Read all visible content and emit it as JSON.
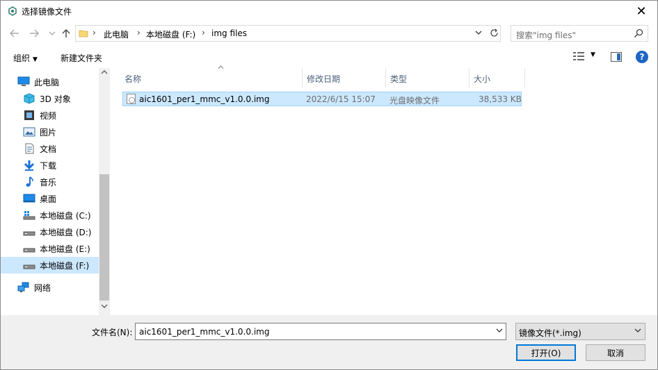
{
  "window": {
    "title": "选择镜像文件",
    "close_glyph": "✕"
  },
  "address": {
    "crumbs": [
      "此电脑",
      "本地磁盘 (F:)",
      "img files"
    ],
    "separator": "›"
  },
  "search": {
    "placeholder": "搜索\"img files\""
  },
  "toolbar": {
    "organize": "组织",
    "new_folder": "新建文件夹"
  },
  "sidebar": {
    "items": [
      {
        "label": "此电脑",
        "icon": "computer-icon"
      },
      {
        "label": "3D 对象",
        "icon": "3d-objects-icon"
      },
      {
        "label": "视频",
        "icon": "video-icon"
      },
      {
        "label": "图片",
        "icon": "picture-icon"
      },
      {
        "label": "文档",
        "icon": "document-icon"
      },
      {
        "label": "下载",
        "icon": "download-icon"
      },
      {
        "label": "音乐",
        "icon": "music-icon"
      },
      {
        "label": "桌面",
        "icon": "desktop-icon"
      },
      {
        "label": "本地磁盘 (C:)",
        "icon": "system-drive-icon"
      },
      {
        "label": "本地磁盘 (D:)",
        "icon": "drive-icon"
      },
      {
        "label": "本地磁盘 (E:)",
        "icon": "drive-icon"
      },
      {
        "label": "本地磁盘 (F:)",
        "icon": "drive-icon",
        "selected": true
      },
      {
        "label": "网络",
        "icon": "network-icon"
      }
    ]
  },
  "columns": {
    "name": "名称",
    "modified": "修改日期",
    "type": "类型",
    "size": "大小"
  },
  "files": [
    {
      "name": "aic1601_per1_mmc_v1.0.0.img",
      "modified": "2022/6/15 15:07",
      "type": "光盘映像文件",
      "size": "38,533 KB"
    }
  ],
  "bottom": {
    "filename_label": "文件名(N):",
    "filename_value": "aic1601_per1_mmc_v1.0.0.img",
    "filetype_value": "镜像文件(*.img)",
    "open_label": "打开(O)",
    "cancel_label": "取消"
  },
  "colors": {
    "selection": "#cce8ff",
    "accent": "#0078d7"
  }
}
